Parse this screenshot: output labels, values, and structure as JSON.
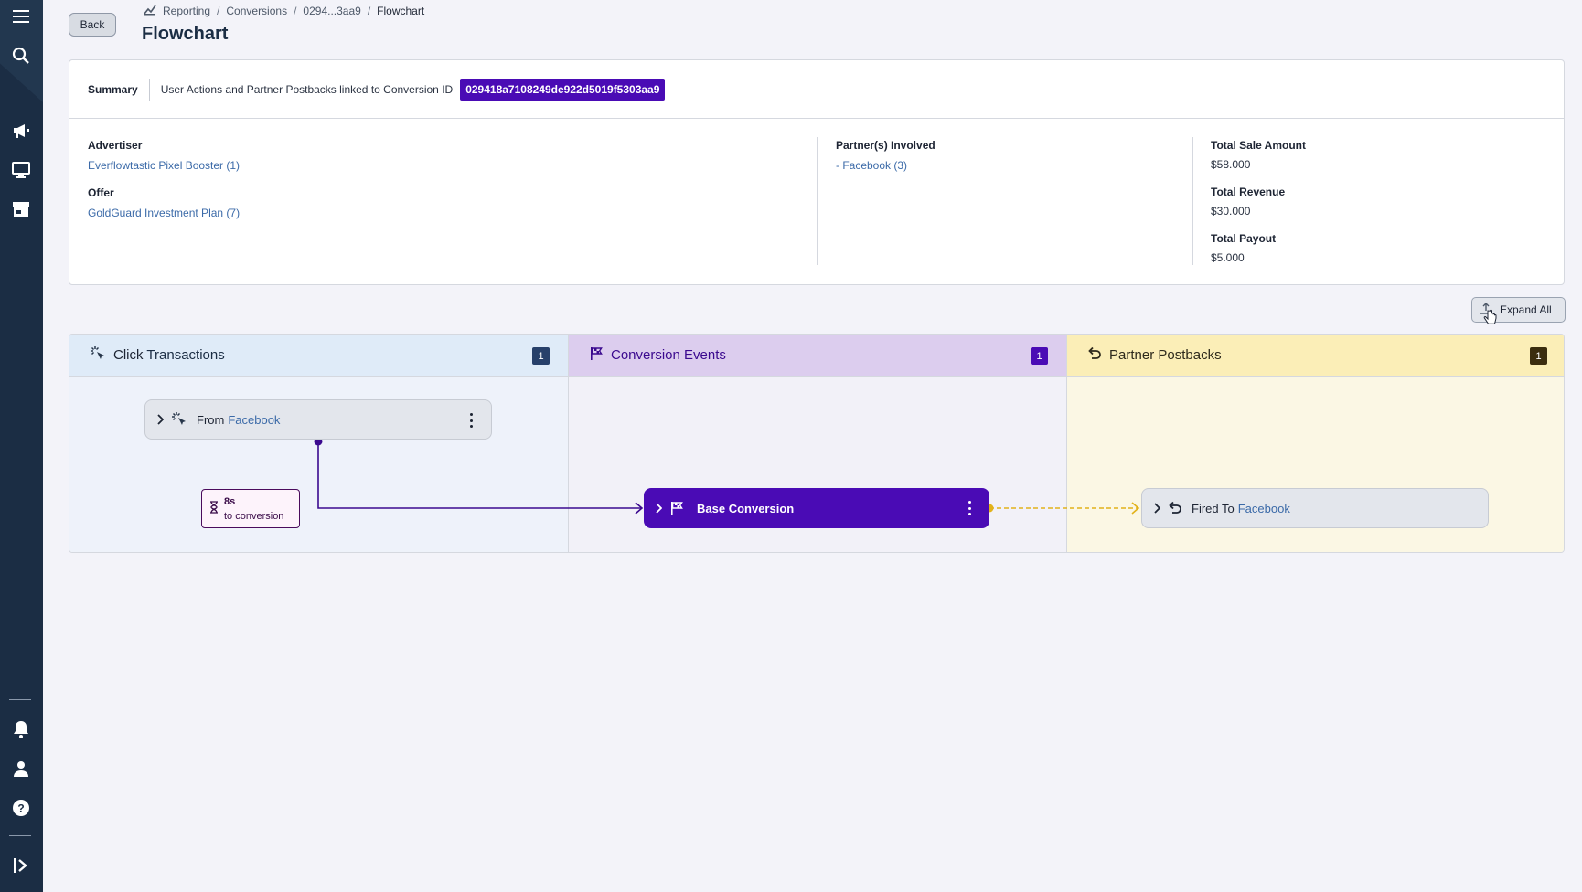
{
  "header": {
    "back_label": "Back",
    "breadcrumb": [
      "Reporting",
      "Conversions",
      "0294...3aa9",
      "Flowchart"
    ],
    "title": "Flowchart"
  },
  "summary": {
    "label": "Summary",
    "description": "User Actions and Partner Postbacks linked to Conversion ID",
    "conversion_id": "029418a7108249de922d5019f5303aa9",
    "advertiser_label": "Advertiser",
    "advertiser_value": "Everflowtastic Pixel Booster (1)",
    "offer_label": "Offer",
    "offer_value": "GoldGuard Investment Plan (7)",
    "partners_label": "Partner(s) Involved",
    "partners_value": "- Facebook (3)",
    "total_sale_label": "Total Sale Amount",
    "total_sale_value": "$58.000",
    "total_revenue_label": "Total Revenue",
    "total_revenue_value": "$30.000",
    "total_payout_label": "Total Payout",
    "total_payout_value": "$5.000"
  },
  "toolbar": {
    "expand_all_label": "Expand All"
  },
  "columns": {
    "clicks": {
      "title_prefix": "Click",
      "title_bold": "Transactions",
      "count": "1"
    },
    "conversions": {
      "title": "Conversion Events",
      "count": "1"
    },
    "postbacks": {
      "title_prefix": "Partner",
      "title_bold": "Postbacks",
      "count": "1"
    }
  },
  "nodes": {
    "click": {
      "prefix": "From",
      "partner": "Facebook"
    },
    "conversion": {
      "label": "Base Conversion"
    },
    "postback": {
      "prefix": "Fired To",
      "partner": "Facebook"
    },
    "timer": {
      "value": "8s",
      "caption": "to conversion"
    }
  },
  "colors": {
    "sidebar": "#1b2d44",
    "accent_purple": "#4a0bb5",
    "click_col_bg": "#eef2fa",
    "click_head_bg": "#dfebf8",
    "conv_col_bg": "#f2f1f8",
    "conv_head_bg": "#dccdee",
    "post_col_bg": "#fbf7e4",
    "post_head_bg": "#fbeeb7",
    "postback_line": "#e2b21a"
  },
  "icons": [
    "menu-icon",
    "search-icon",
    "megaphone-icon",
    "monitor-icon",
    "store-icon",
    "bell-icon",
    "user-icon",
    "help-icon",
    "collapse-sidebar-icon"
  ]
}
